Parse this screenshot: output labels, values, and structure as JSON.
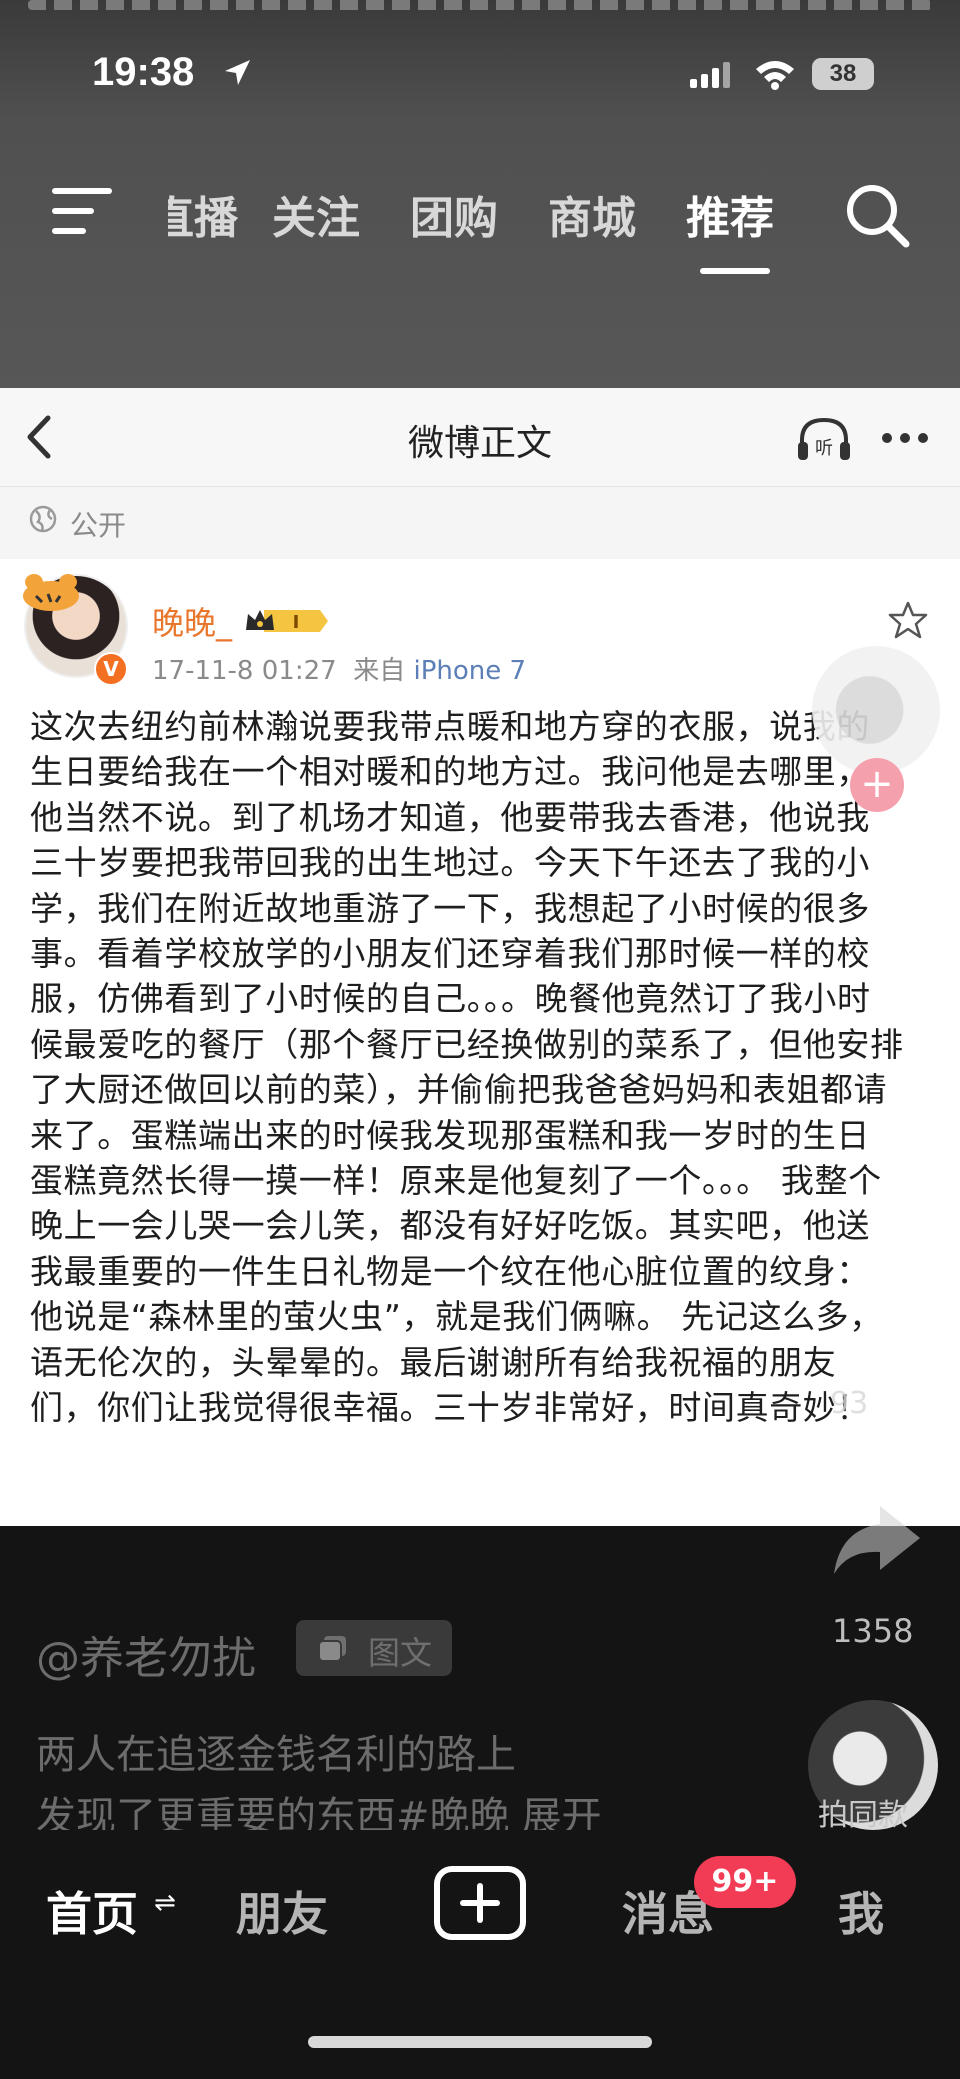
{
  "status_bar": {
    "time": "19:38",
    "battery": "38"
  },
  "top_nav": {
    "tabs": [
      {
        "label": "直播",
        "active": false
      },
      {
        "label": "关注",
        "active": false
      },
      {
        "label": "团购",
        "active": false
      },
      {
        "label": "商城",
        "active": false
      },
      {
        "label": "推荐",
        "active": true
      }
    ]
  },
  "card": {
    "title": "微博正文",
    "visibility": "公开",
    "author": {
      "name": "晚晚_",
      "vip_level": "I"
    },
    "meta": {
      "date": "17-11-8 01:27",
      "source_prefix": "来自",
      "source": "iPhone 7"
    },
    "body_lines": [
      "这次去纽约前林瀚说要我带点暖和地方穿的衣服，说我的",
      "生日要给我在一个相对暖和的地方过。我问他是去哪里，",
      "他当然不说。到了机场才知道，他要带我去香港，他说我",
      "三十岁要把我带回我的出生地过。今天下午还去了我的小",
      "学，我们在附近故地重游了一下，我想起了小时候的很多",
      "事。看着学校放学的小朋友们还穿着我们那时候一样的校",
      "服，仿佛看到了小时候的自己。。。晚餐他竟然订了我小时",
      "候最爱吃的餐厅（那个餐厅已经换做别的菜系了，但他安排",
      "了大厨还做回以前的菜），并偷偷把我爸爸妈妈和表姐都请",
      "来了。蛋糕端出来的时候我发现那蛋糕和我一岁时的生日",
      "蛋糕竟然长得一摸一样！原来是他复刻了一个。。。 我整个",
      "晚上一会儿哭一会儿笑，都没有好好吃饭。其实吧，他送",
      "我最重要的一件生日礼物是一个纹在他心脏位置的纹身：",
      "他说是“森林里的萤火虫”，就是我们俩嘛。 先记这么多，",
      "语无伦次的，头晕晕的。最后谢谢所有给我祝福的朋友",
      "们，你们让我觉得很幸福。三十岁非常好，时间真奇妙！"
    ]
  },
  "side": {
    "like_count": "93",
    "share_count": "1358",
    "music_label": "拍同款"
  },
  "post": {
    "author_handle": "@养老勿扰",
    "type_tag": "图文",
    "desc_line1": "两人在追逐金钱名利的路上",
    "desc_line2": "发现了更重要的东西#晚晚",
    "expand": "展开"
  },
  "tabbar": {
    "home": "首页",
    "home_switch": "⇌",
    "friends": "朋友",
    "messages": "消息",
    "messages_badge": "99+",
    "me": "我"
  }
}
